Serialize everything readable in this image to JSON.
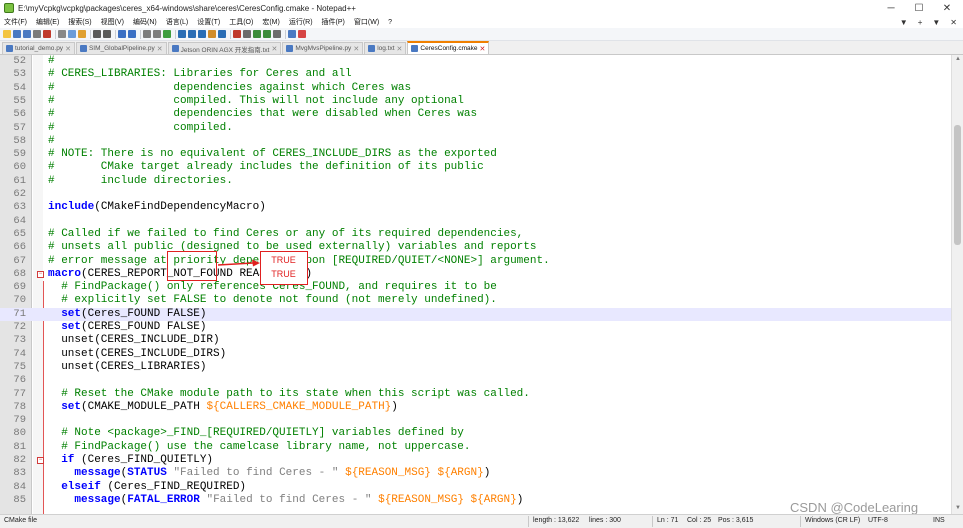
{
  "window": {
    "title": "E:\\myVcpkg\\vcpkg\\packages\\ceres_x64-windows\\share\\ceres\\CeresConfig.cmake - Notepad++",
    "minimize_glyph": "─",
    "maximize_glyph": "☐",
    "close_glyph": "✕"
  },
  "menu": {
    "items": [
      "文件(F)",
      "编辑(E)",
      "搜索(S)",
      "视图(V)",
      "编码(N)",
      "语言(L)",
      "设置(T)",
      "工具(O)",
      "宏(M)",
      "运行(R)",
      "插件(P)",
      "窗口(W)",
      "?"
    ],
    "right": [
      "▼",
      "+",
      "▼",
      "✕"
    ]
  },
  "tabs": [
    {
      "label": "tutorial_demo.py",
      "active": false
    },
    {
      "label": "SIM_GlobalPipeline.py",
      "active": false
    },
    {
      "label": "Jetson ORIN AGX 开发指南.txt",
      "active": false
    },
    {
      "label": "MvgMvsPipeline.py",
      "active": false
    },
    {
      "label": "log.txt",
      "active": false
    },
    {
      "label": "CeresConfig.cmake",
      "active": true
    }
  ],
  "tab_close_glyph": "✕",
  "editor": {
    "current_line": 71,
    "lines": [
      {
        "n": 52,
        "tokens": [
          {
            "t": "#",
            "c": "comment"
          }
        ]
      },
      {
        "n": 53,
        "tokens": [
          {
            "t": "# CERES_LIBRARIES: Libraries for Ceres and all",
            "c": "comment"
          }
        ]
      },
      {
        "n": 54,
        "tokens": [
          {
            "t": "#                  dependencies against which Ceres was",
            "c": "comment"
          }
        ]
      },
      {
        "n": 55,
        "tokens": [
          {
            "t": "#                  compiled. This will not include any optional",
            "c": "comment"
          }
        ]
      },
      {
        "n": 56,
        "tokens": [
          {
            "t": "#                  dependencies that were disabled when Ceres was",
            "c": "comment"
          }
        ]
      },
      {
        "n": 57,
        "tokens": [
          {
            "t": "#                  compiled.",
            "c": "comment"
          }
        ]
      },
      {
        "n": 58,
        "tokens": [
          {
            "t": "#",
            "c": "comment"
          }
        ]
      },
      {
        "n": 59,
        "tokens": [
          {
            "t": "# NOTE: There is no equivalent of CERES_INCLUDE_DIRS as the exported",
            "c": "comment"
          }
        ]
      },
      {
        "n": 60,
        "tokens": [
          {
            "t": "#       CMake target already includes the definition of its public",
            "c": "comment"
          }
        ]
      },
      {
        "n": 61,
        "tokens": [
          {
            "t": "#       include directories.",
            "c": "comment"
          }
        ]
      },
      {
        "n": 62,
        "tokens": []
      },
      {
        "n": 63,
        "tokens": [
          {
            "t": "include",
            "c": "keyword"
          },
          {
            "t": "(CMakeFindDependencyMacro)",
            "c": "text"
          }
        ]
      },
      {
        "n": 64,
        "tokens": []
      },
      {
        "n": 65,
        "tokens": [
          {
            "t": "# Called if we failed to find Ceres or any of its required dependencies,",
            "c": "comment"
          }
        ]
      },
      {
        "n": 66,
        "tokens": [
          {
            "t": "# unsets all public (designed to be used externally) variables and reports",
            "c": "comment"
          }
        ]
      },
      {
        "n": 67,
        "tokens": [
          {
            "t": "# error message at priority depending upon [REQUIRED/QUIET/<NONE>] argument.",
            "c": "comment"
          }
        ]
      },
      {
        "n": 68,
        "fold": "−",
        "tokens": [
          {
            "t": "macro",
            "c": "keyword"
          },
          {
            "t": "(CERES_REPORT_NOT_FOUND REASON_MSG)",
            "c": "text"
          }
        ]
      },
      {
        "n": 69,
        "tokens": [
          {
            "t": "  # FindPackage() only references Ceres_FOUND, and requires it to be",
            "c": "comment"
          }
        ]
      },
      {
        "n": 70,
        "tokens": [
          {
            "t": "  # explicitly set FALSE to denote not found (not merely undefined).",
            "c": "comment"
          }
        ]
      },
      {
        "n": 71,
        "tokens": [
          {
            "t": "  set",
            "c": "keyword"
          },
          {
            "t": "(Ceres_FOUND FALSE)",
            "c": "text"
          }
        ]
      },
      {
        "n": 72,
        "tokens": [
          {
            "t": "  set",
            "c": "keyword"
          },
          {
            "t": "(CERES_FOUND FALSE)",
            "c": "text"
          }
        ]
      },
      {
        "n": 73,
        "tokens": [
          {
            "t": "  unset(CERES_INCLUDE_DIR)",
            "c": "text"
          }
        ]
      },
      {
        "n": 74,
        "tokens": [
          {
            "t": "  unset(CERES_INCLUDE_DIRS)",
            "c": "text"
          }
        ]
      },
      {
        "n": 75,
        "tokens": [
          {
            "t": "  unset(CERES_LIBRARIES)",
            "c": "text"
          }
        ]
      },
      {
        "n": 76,
        "tokens": []
      },
      {
        "n": 77,
        "tokens": [
          {
            "t": "  # Reset the CMake module path to its state when this script was called.",
            "c": "comment"
          }
        ]
      },
      {
        "n": 78,
        "tokens": [
          {
            "t": "  set",
            "c": "keyword"
          },
          {
            "t": "(CMAKE_MODULE_PATH ",
            "c": "text"
          },
          {
            "t": "${CALLERS_CMAKE_MODULE_PATH}",
            "c": "var"
          },
          {
            "t": ")",
            "c": "text"
          }
        ]
      },
      {
        "n": 79,
        "tokens": []
      },
      {
        "n": 80,
        "tokens": [
          {
            "t": "  # Note <package>_FIND_[REQUIRED/QUIETLY] variables defined by",
            "c": "comment"
          }
        ]
      },
      {
        "n": 81,
        "tokens": [
          {
            "t": "  # FindPackage() use the camelcase library name, not uppercase.",
            "c": "comment"
          }
        ]
      },
      {
        "n": 82,
        "fold": "−",
        "tokens": [
          {
            "t": "  if",
            "c": "keyword"
          },
          {
            "t": " (Ceres_FIND_QUIETLY)",
            "c": "text"
          }
        ]
      },
      {
        "n": 83,
        "tokens": [
          {
            "t": "    message",
            "c": "keyword"
          },
          {
            "t": "(",
            "c": "text"
          },
          {
            "t": "STATUS",
            "c": "keyword"
          },
          {
            "t": " ",
            "c": "text"
          },
          {
            "t": "\"Failed to find Ceres - \"",
            "c": "string"
          },
          {
            "t": " ",
            "c": "text"
          },
          {
            "t": "${REASON_MSG} ${ARGN}",
            "c": "var"
          },
          {
            "t": ")",
            "c": "text"
          }
        ]
      },
      {
        "n": 84,
        "tokens": [
          {
            "t": "  elseif",
            "c": "keyword"
          },
          {
            "t": " (Ceres_FIND_REQUIRED)",
            "c": "text"
          }
        ]
      },
      {
        "n": 85,
        "tokens": [
          {
            "t": "    message",
            "c": "keyword"
          },
          {
            "t": "(",
            "c": "text"
          },
          {
            "t": "FATAL_ERROR",
            "c": "keyword"
          },
          {
            "t": " ",
            "c": "text"
          },
          {
            "t": "\"Failed to find Ceres - \"",
            "c": "string"
          },
          {
            "t": " ",
            "c": "text"
          },
          {
            "t": "${REASON_MSG} ${ARGN}",
            "c": "var"
          },
          {
            "t": ")",
            "c": "text"
          }
        ]
      }
    ]
  },
  "annotation": {
    "replacements": [
      "TRUE",
      "TRUE"
    ],
    "color": "#e02020"
  },
  "statusbar": {
    "file_type": "CMake file",
    "length": "length : 13,622",
    "lines": "lines : 300",
    "ln": "Ln : 71",
    "col": "Col : 25",
    "pos": "Pos : 3,615",
    "eol": "Windows (CR LF)",
    "encoding": "UTF-8",
    "mode": "INS"
  },
  "watermark": "CSDN @CodeLearing",
  "colors": {
    "comment": "#008000",
    "keyword": "#0000ff",
    "string": "#808080",
    "variable": "#ff8000",
    "current_line": "#e8e8ff",
    "active_tab_accent": "#f08000"
  }
}
